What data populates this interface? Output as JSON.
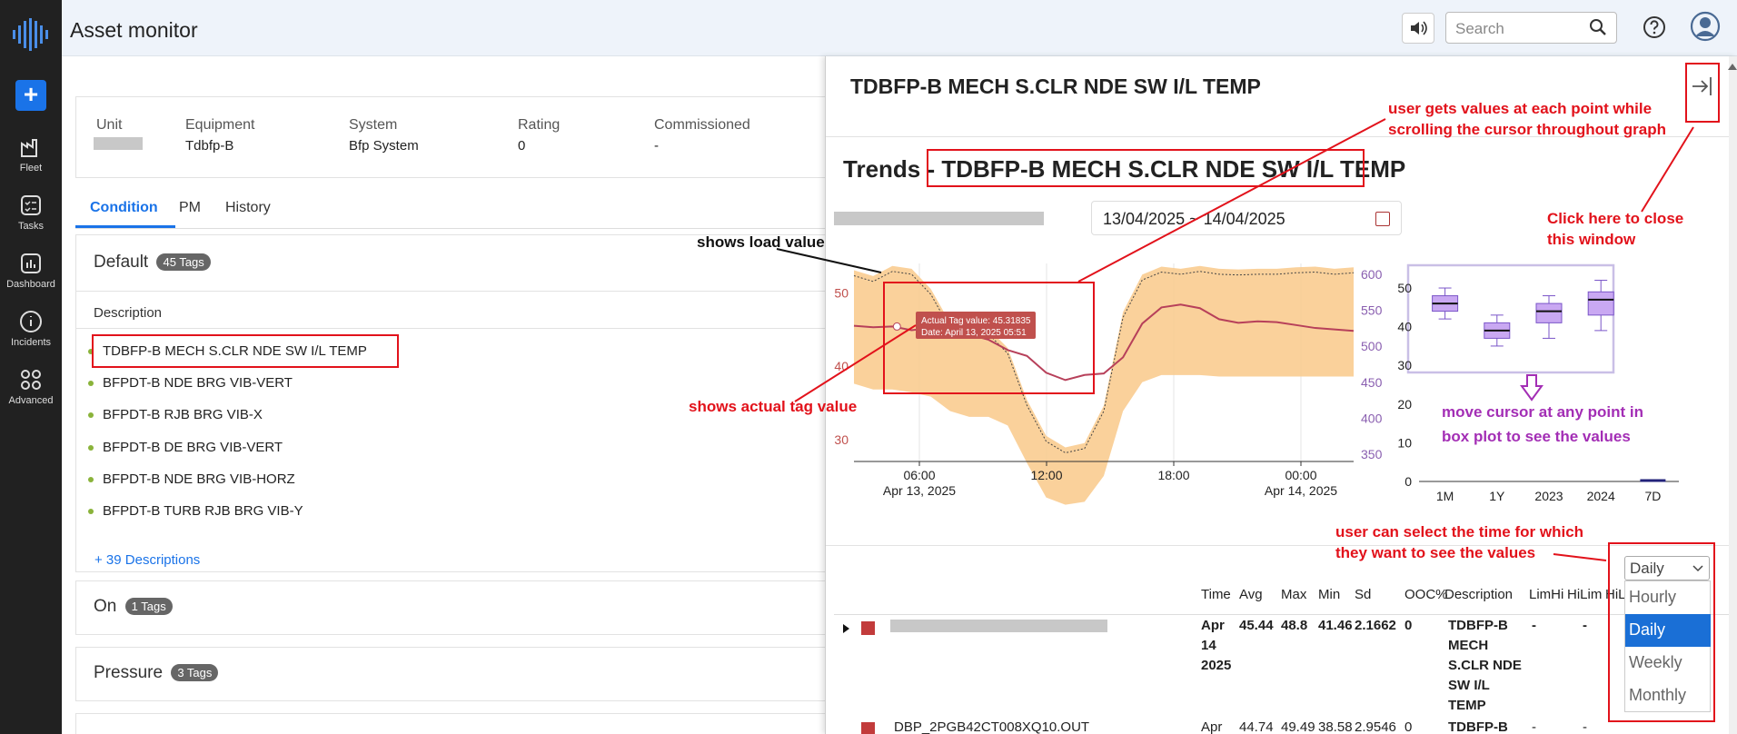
{
  "app": {
    "title": "Asset monitor"
  },
  "nav": {
    "items": [
      {
        "label": "Fleet",
        "icon": "fleet-icon"
      },
      {
        "label": "Tasks",
        "icon": "tasks-icon"
      },
      {
        "label": "Dashboard",
        "icon": "dashboard-icon"
      },
      {
        "label": "Incidents",
        "icon": "incidents-icon"
      },
      {
        "label": "Advanced",
        "icon": "advanced-icon"
      }
    ],
    "add_label": "+"
  },
  "header": {
    "search_placeholder": "Search"
  },
  "asset": {
    "unit_label": "Unit",
    "equipment_label": "Equipment",
    "equipment": "Tdbfp-B",
    "system_label": "System",
    "system": "Bfp System",
    "rating_label": "Rating",
    "rating": "0",
    "commissioned_label": "Commissioned",
    "commissioned": "-"
  },
  "tabs": [
    "Condition",
    "PM",
    "History"
  ],
  "groups": {
    "default": {
      "name": "Default",
      "tags": "45 Tags"
    },
    "on": {
      "name": "On",
      "tags": "1 Tags"
    },
    "pressure": {
      "name": "Pressure",
      "tags": "3 Tags"
    }
  },
  "description_header": "Description",
  "descriptions": [
    "TDBFP-B MECH S.CLR NDE SW I/L TEMP",
    "BFPDT-B NDE BRG VIB-VERT",
    "BFPDT-B RJB BRG VIB-X",
    "BFPDT-B DE BRG VIB-VERT",
    "BFPDT-B NDE BRG VIB-HORZ",
    "BFPDT-B TURB RJB BRG VIB-Y"
  ],
  "more_descriptions": "+ 39 Descriptions",
  "panel": {
    "title": "TDBFP-B MECH S.CLR NDE SW I/L TEMP",
    "trends_prefix": "Trends - ",
    "trends_title": "TDBFP-B MECH S.CLR NDE SW I/L TEMP",
    "date_range": "13/04/2025 ~ 14/04/2025"
  },
  "chart_data": [
    {
      "type": "line",
      "x_ticks": [
        "06:00",
        "12:00",
        "18:00",
        "00:00"
      ],
      "x_subticks": [
        "Apr 13, 2025",
        "",
        "",
        "Apr 14, 2025"
      ],
      "y_left_ticks": [
        30,
        40,
        50
      ],
      "y_right_ticks": [
        350,
        400,
        450,
        500,
        550,
        600
      ],
      "ylim_left": [
        27,
        54
      ],
      "ylim_right": [
        340,
        615
      ],
      "series": [
        {
          "values": [
            45.5,
            45.3,
            45.4,
            44.9,
            45.2,
            45.3,
            44.3,
            43.6,
            42.2,
            41.4,
            39.1,
            38.1,
            38.8,
            39.0,
            41.2,
            45.8,
            48.0,
            48.4,
            47.9,
            46.4,
            45.9,
            46.1,
            46.0,
            45.6,
            45.2,
            45.0,
            44.8
          ],
          "color": "#b7405a"
        },
        {
          "values": [
            598,
            590,
            604,
            600,
            572,
            525,
            512,
            517,
            490,
            418,
            368,
            352,
            358,
            410,
            540,
            592,
            603,
            600,
            604,
            600,
            599,
            600,
            600,
            602,
            603,
            600,
            602
          ],
          "color": "#444444"
        }
      ],
      "tooltip": {
        "line1": "Actual Tag value: 45.31835",
        "line2": "Date: April 13, 2025 05:51"
      }
    },
    {
      "type": "box",
      "categories": [
        "1M",
        "1Y",
        "2023",
        "2024",
        "7D"
      ],
      "y_ticks": [
        0,
        10,
        20,
        30,
        40,
        50
      ],
      "ylim": [
        0,
        54
      ],
      "boxes": [
        {
          "min": 42,
          "q1": 44,
          "median": 46,
          "q3": 48,
          "max": 50
        },
        {
          "min": 35,
          "q1": 37,
          "median": 39,
          "q3": 41,
          "max": 43
        },
        {
          "min": 37,
          "q1": 41,
          "median": 44,
          "q3": 46,
          "max": 48
        },
        {
          "min": 39,
          "q1": 43,
          "median": 47,
          "q3": 49,
          "max": 52
        },
        {
          "min": 0,
          "q1": 0,
          "median": 0,
          "q3": 0,
          "max": 0
        }
      ]
    }
  ],
  "table": {
    "headers": [
      "Time",
      "Avg",
      "Max",
      "Min",
      "Sd",
      "OOC%",
      "Description",
      "LimHi",
      "HiLim",
      "HiL"
    ],
    "rows": [
      {
        "time": "Apr 14 2025",
        "avg": "45.44",
        "max": "48.8",
        "min": "41.46",
        "sd": "2.1662",
        "ooc": "0",
        "desc": "TDBFP-B MECH S.CLR NDE SW I/L TEMP",
        "l1": "-",
        "l2": "-",
        "l3": "-",
        "l4": "-"
      },
      {
        "tag": "DBP_2PGB42CT008XQ10.OUT",
        "time": "Apr",
        "avg": "44.74",
        "max": "49.49",
        "min": "38.58",
        "sd": "2.9546",
        "ooc": "0",
        "desc": "TDBFP-B",
        "l1": "-",
        "l2": "-",
        "l3": "-",
        "l4": "-"
      }
    ]
  },
  "select": {
    "value": "Daily",
    "options": [
      "Hourly",
      "Daily",
      "Weekly",
      "Monthly"
    ]
  },
  "annotations": {
    "cursor": "user gets values at each point while scrolling the cursor throughout graph",
    "close": "Click here to close this window",
    "load": "shows load value",
    "tag": "shows actual tag value",
    "box": "move cursor at any point in box plot to see the values",
    "time": "user can select the time for which they want to see the values"
  },
  "colors": {
    "accent": "#1a73e8",
    "annotation": "#e2121b",
    "band": "#f9c98a",
    "trend": "#b7405a",
    "box": "#c9a8f2"
  }
}
